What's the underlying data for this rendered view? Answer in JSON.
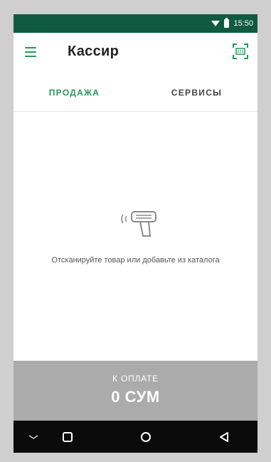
{
  "status_bar": {
    "time": "15:50",
    "icons": [
      "wifi-icon",
      "battery-icon"
    ]
  },
  "app_bar": {
    "title": "Кассир",
    "menu_icon": "hamburger-menu-icon",
    "scan_icon": "barcode-scan-icon"
  },
  "tabs": [
    {
      "label": "ПРОДАЖА",
      "active": true
    },
    {
      "label": "СЕРВИСЫ",
      "active": false
    }
  ],
  "content": {
    "empty_state_text": "Отсканируйте товар или добавьте из каталога",
    "illustration": "barcode-scanner-icon"
  },
  "fab": {
    "label": "+",
    "icon": "plus-icon"
  },
  "payment": {
    "label": "К ОПЛАТЕ",
    "amount": "0 СУМ"
  },
  "system_nav": {
    "buttons": [
      "chevron-down-icon",
      "recent-apps-icon",
      "home-icon",
      "back-icon"
    ]
  },
  "colors": {
    "status_bar": "#0f5a41",
    "accent": "#1f9a5b",
    "fab": "#1f9a4d",
    "payment_bar": "#ababab",
    "nav_bar": "#0b0b0b"
  }
}
